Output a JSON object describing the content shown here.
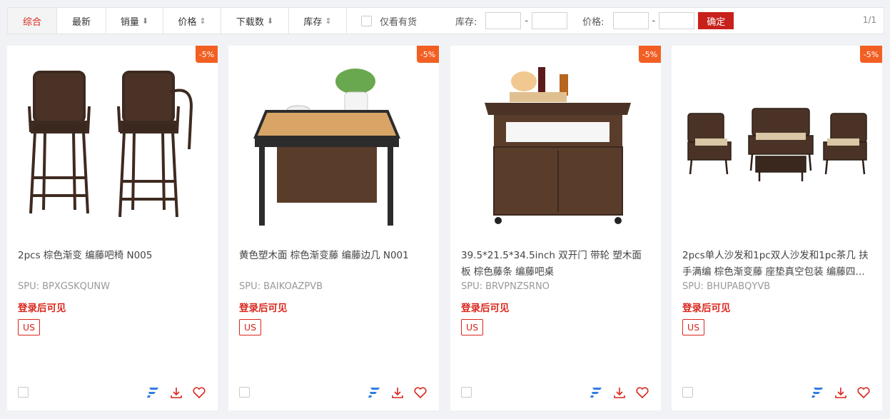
{
  "toolbar": {
    "tabs": [
      {
        "label": "综合",
        "arrow": ""
      },
      {
        "label": "最新",
        "arrow": ""
      },
      {
        "label": "销量",
        "arrow": "⬇"
      },
      {
        "label": "价格",
        "arrow": "⇕"
      },
      {
        "label": "下载数",
        "arrow": "⬇"
      },
      {
        "label": "库存",
        "arrow": "⇕"
      }
    ],
    "in_stock_label": "仅看有货",
    "stock_label": "库存:",
    "price_label": "价格:",
    "dash": "-",
    "confirm_label": "确定",
    "page_indicator": "1/1"
  },
  "accent_color": "#d9261c",
  "badge_color": "#f25f23",
  "products": [
    {
      "badge": "-5%",
      "title": "2pcs 棕色渐变 编藤吧椅 N005",
      "spu": "SPU:  BPXGSKQUNW",
      "login_text": "登录后可见",
      "tag": "US",
      "image": "bar-chairs"
    },
    {
      "badge": "-5%",
      "title": "黄色塑木面 棕色渐变藤 编藤边几 N001",
      "spu": "SPU:  BAIKOAZPVB",
      "login_text": "登录后可见",
      "tag": "US",
      "image": "side-table"
    },
    {
      "badge": "-5%",
      "title": "39.5*21.5*34.5inch 双开门 带轮 塑木面板 棕色藤条 编藤吧桌",
      "spu": "SPU:  BRVPNZSRNO",
      "login_text": "登录后可见",
      "tag": "US",
      "image": "bar-cart"
    },
    {
      "badge": "-5%",
      "title": "2pcs单人沙发和1pc双人沙发和1pc茶几 扶手满编 棕色渐变藤 座垫真空包装 编藤四…",
      "spu": "SPU:  BHUPABQYVB",
      "login_text": "登录后可见",
      "tag": "US",
      "image": "sofa-set"
    }
  ]
}
